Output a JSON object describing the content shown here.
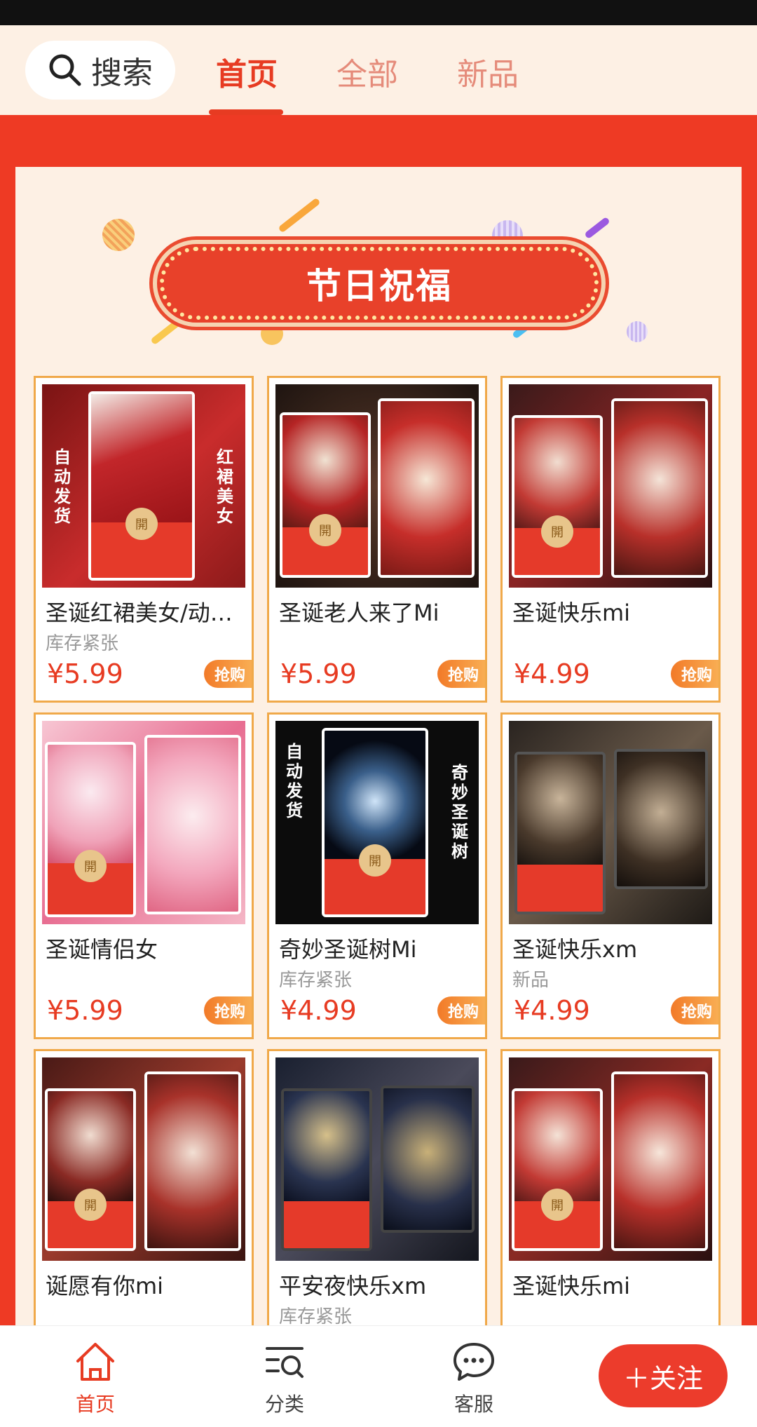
{
  "topnav": {
    "search_label": "搜索",
    "tabs": [
      {
        "label": "首页",
        "active": true
      },
      {
        "label": "全部",
        "active": false
      },
      {
        "label": "新品",
        "active": false
      }
    ]
  },
  "banner": {
    "title": "节日祝福"
  },
  "products": [
    {
      "title": "圣诞红裙美女/动…",
      "sub": "库存紧张",
      "price": "¥5.99",
      "buy": "抢购",
      "art_left": "自动发货",
      "art_right": "红裙美女",
      "seal": "開"
    },
    {
      "title": "圣诞老人来了Mi",
      "sub": "",
      "price": "¥5.99",
      "buy": "抢购",
      "seal": "開"
    },
    {
      "title": "圣诞快乐mi",
      "sub": "",
      "price": "¥4.99",
      "buy": "抢购",
      "seal": "開"
    },
    {
      "title": "圣诞情侣女",
      "sub": "",
      "price": "¥5.99",
      "buy": "抢购",
      "seal": "開"
    },
    {
      "title": "奇妙圣诞树Mi",
      "sub": "库存紧张",
      "price": "¥4.99",
      "buy": "抢购",
      "art_left": "自动发货",
      "art_right": "奇妙圣诞树",
      "seal": "開"
    },
    {
      "title": "圣诞快乐xm",
      "sub": "新品",
      "price": "¥4.99",
      "buy": "抢购",
      "seal": ""
    },
    {
      "title": "诞愿有你mi",
      "sub": "",
      "price": "",
      "buy": "",
      "seal": "開"
    },
    {
      "title": "平安夜快乐xm",
      "sub": "库存紧张",
      "price": "",
      "buy": "",
      "seal": ""
    },
    {
      "title": "圣诞快乐mi",
      "sub": "",
      "price": "",
      "buy": "",
      "seal": "開"
    }
  ],
  "bottombar": {
    "items": [
      {
        "label": "首页",
        "icon": "home-icon",
        "active": true
      },
      {
        "label": "分类",
        "icon": "category-search-icon",
        "active": false
      },
      {
        "label": "客服",
        "icon": "chat-bubble-icon",
        "active": false
      }
    ],
    "follow_label": "＋关注"
  },
  "colors": {
    "accent": "#e73b22",
    "panel": "#fdf0e4",
    "border": "#f0a94a"
  }
}
